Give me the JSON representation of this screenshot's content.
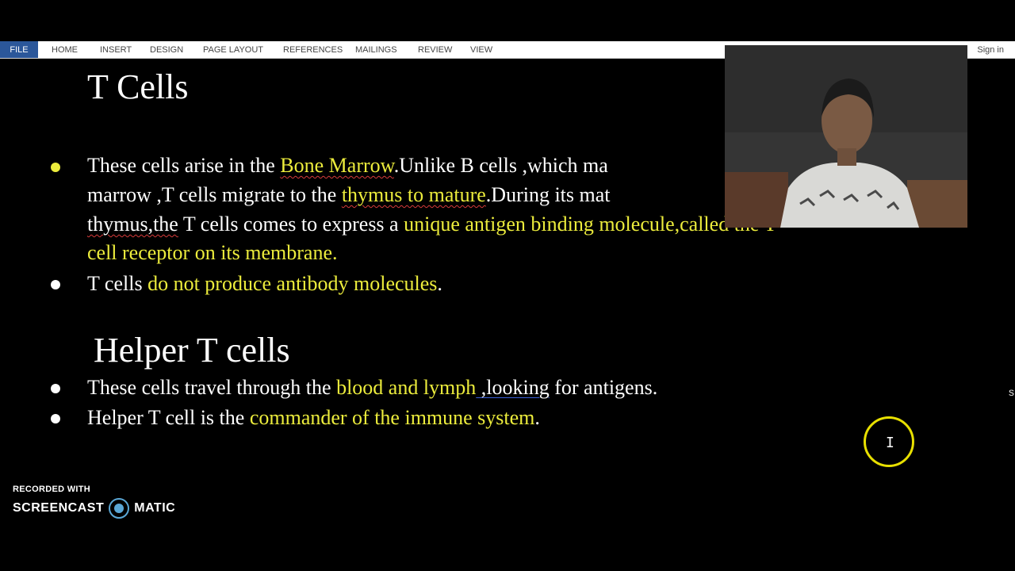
{
  "ribbon": {
    "file": "FILE",
    "tabs": [
      "HOME",
      "INSERT",
      "DESIGN",
      "PAGE LAYOUT",
      "REFERENCES",
      "MAILINGS",
      "REVIEW",
      "VIEW"
    ],
    "signin": "Sign in"
  },
  "colors": {
    "highlight": "#ecec3c",
    "file_tab": "#2b579a",
    "cursor_ring": "#e8e000"
  },
  "doc": {
    "title1": "T Cells",
    "b1": {
      "l1a": "These cells arise in the ",
      "l1b": "Bone Marrow",
      "l1c": ".Unlike B cells ,which ma",
      "l2a": "marrow ,T cells migrate to the ",
      "l2b": "thymus to mature",
      "l2c": ".During its mat",
      "l3a": "thymus,the",
      "l3b": " T cells comes to express a ",
      "l3c": "unique antigen binding molecule,called the T",
      "l4": "cell receptor on its membrane."
    },
    "b2": {
      "a": "T cells ",
      "b": "do not produce antibody molecules",
      "c": "."
    },
    "title2": "Helper T cells",
    "b3": {
      "a": "These cells travel through the ",
      "b": "blood and lymph",
      "c": " ,looking",
      "d": " for antigens."
    },
    "b4": {
      "a": "Helper T cell is the ",
      "b": "commander of the immune system",
      "c": "."
    }
  },
  "watermark": {
    "line1": "RECORDED WITH",
    "left": "SCREENCAST",
    "right": "MATIC"
  },
  "edge_char": "s"
}
